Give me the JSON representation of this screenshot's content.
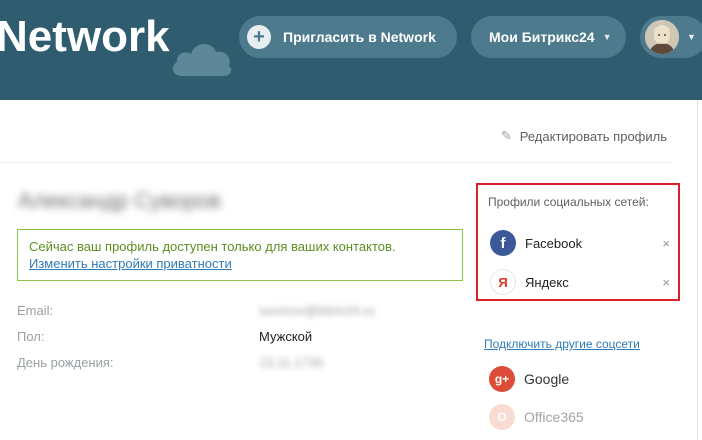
{
  "header": {
    "brand": "Network",
    "invite_label": "Пригласить в Network",
    "bitrix_label": "Мои Битрикс24",
    "user_avatar": "user-avatar"
  },
  "profile": {
    "edit_label": "Редактировать профиль",
    "name": "Александр Суворов",
    "notice_text": "Сейчас ваш профиль доступен только для ваших контактов.",
    "notice_link": "Изменить настройки приватности",
    "fields": [
      {
        "label": "Email:",
        "value": "suvorov@bitrix24.ru"
      },
      {
        "label": "Пол:",
        "value": "Мужской"
      },
      {
        "label": "День рождения:",
        "value": "13.11.1730"
      }
    ]
  },
  "social": {
    "title": "Профили социальных сетей:",
    "connected": [
      {
        "name": "Facebook",
        "icon": "facebook-icon",
        "icon_glyph": "f",
        "remove": "×"
      },
      {
        "name": "Яндекс",
        "icon": "yandex-icon",
        "icon_glyph": "Я",
        "remove": "×"
      }
    ],
    "connect_link": "Подключить другие соцсети",
    "others": [
      {
        "name": "Google",
        "icon": "google-plus-icon",
        "icon_glyph": "g+"
      },
      {
        "name": "Office365",
        "icon": "office365-icon",
        "icon_glyph": "O"
      }
    ]
  },
  "colors": {
    "header_bg": "#2f5c6f",
    "pill_bg": "#4d7b8d",
    "highlight_border": "#d9202b",
    "notice_border": "#8bc34a",
    "link": "#2f7ab9"
  }
}
